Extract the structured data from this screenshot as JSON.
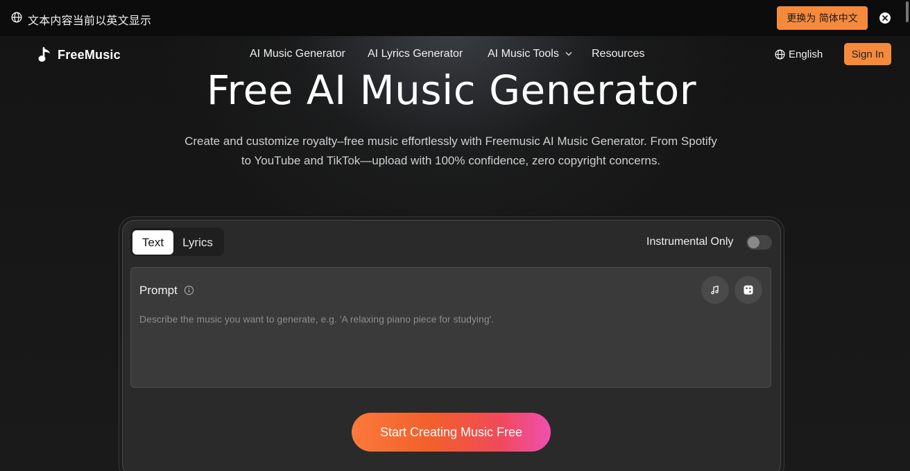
{
  "banner": {
    "message": "文本内容当前以英文显示",
    "switch_label": "更换为 简体中文"
  },
  "nav": {
    "brand": "FreeMusic",
    "items": [
      "AI Music Generator",
      "AI Lyrics Generator",
      "AI Music Tools",
      "Resources"
    ],
    "language": "English",
    "signin": "Sign In"
  },
  "hero": {
    "title": "Free AI Music Generator",
    "subtitle": "Create and customize royalty–free music effortlessly with Freemusic AI Music Generator. From Spotify to YouTube and TikTok—upload with 100% confidence, zero copyright concerns."
  },
  "generator": {
    "tabs": [
      {
        "label": "Text",
        "active": true
      },
      {
        "label": "Lyrics",
        "active": false
      }
    ],
    "instrumental_label": "Instrumental Only",
    "instrumental_on": false,
    "prompt_label": "Prompt",
    "prompt_placeholder": "Describe the music you want to generate, e.g. 'A relaxing piano piece for studying'.",
    "cta": "Start Creating Music Free"
  },
  "colors": {
    "accent": "#f58a3c",
    "background": "#151515"
  }
}
